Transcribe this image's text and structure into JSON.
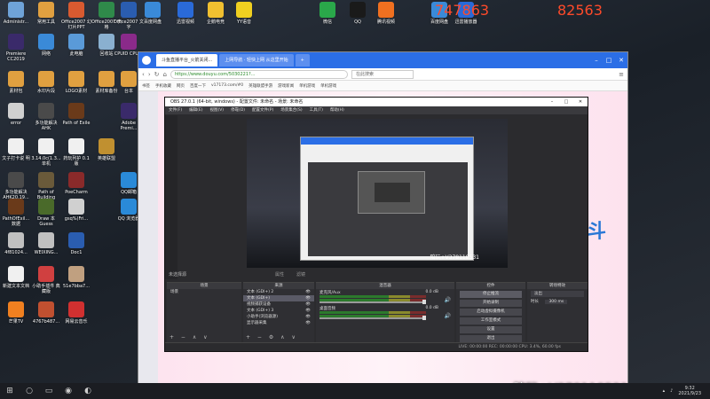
{
  "desktop": {
    "overlay_left": "747863",
    "overlay_right": "82563",
    "watermark": "陪玩+V378118531",
    "left_icons": [
      {
        "label": "Administr...",
        "color": "#6fa3d8"
      },
      {
        "label": "常用工具",
        "color": "#e0a040"
      },
      {
        "label": "Office2007 幻灯片PPT",
        "color": "#d85a30"
      },
      {
        "label": "Office2007 表格",
        "color": "#2f8a4a"
      },
      {
        "label": "Office2007 文字",
        "color": "#2a5db0"
      },
      {
        "label": "Premiere CC2019",
        "color": "#3a2a6a"
      },
      {
        "label": "网络",
        "color": "#3a8ad8"
      },
      {
        "label": "此电脑",
        "color": "#5a9ad8"
      },
      {
        "label": "回收站",
        "color": "#8ab0d0"
      },
      {
        "label": "CPUID CPU-Z",
        "color": "#8a2a8a"
      },
      {
        "label": "素材包",
        "color": "#e0a040"
      },
      {
        "label": "水印片段",
        "color": "#e0a040"
      },
      {
        "label": "LOGO素材",
        "color": "#e0a040"
      },
      {
        "label": "素材库备份",
        "color": "#e0a040"
      },
      {
        "label": "台本",
        "color": "#e0a040"
      },
      {
        "label": "error",
        "color": "#d0d0d0"
      },
      {
        "label": "多功能解决 AHK",
        "color": "#4a4a4a"
      },
      {
        "label": "Path of Exile",
        "color": "#6a3a1a"
      },
      {
        "label": "Adobe Premi...",
        "color": "#3a2a6a"
      },
      {
        "label": "文子打卡说 明",
        "color": "#f0f0f0"
      },
      {
        "label": "3.14.0c(1.3... 单机",
        "color": "#f0f0f0"
      },
      {
        "label": "药玩列护 0.1 版",
        "color": "#f0f0f0"
      },
      {
        "label": "英雄联盟",
        "color": "#c09030"
      },
      {
        "label": "多功能解决 AHK20.19...",
        "color": "#4a4a4a"
      },
      {
        "label": "Path of Building",
        "color": "#6a5a3a"
      },
      {
        "label": "PoeCharm",
        "color": "#8a2a2a"
      },
      {
        "label": "QQ邮箱",
        "color": "#2a8ad8"
      },
      {
        "label": "PathOfExil... 数据",
        "color": "#6a3a1a"
      },
      {
        "label": "Draw 本 Guess",
        "color": "#4a6a2a"
      },
      {
        "label": "gsq%(Fri...",
        "color": "#d0d0d0"
      },
      {
        "label": "QQ 浏览器",
        "color": "#2a8ad8"
      },
      {
        "label": "4f81024...",
        "color": "#c0c0c0"
      },
      {
        "label": "WEIXING...",
        "color": "#c0c0c0"
      },
      {
        "label": "Doc1",
        "color": "#2a5db0"
      },
      {
        "label": "新建文本文档",
        "color": "#f0f0f0"
      },
      {
        "label": "小助手插件 典藏版",
        "color": "#d04040"
      },
      {
        "label": "51e7bba7...",
        "color": "#c0a080"
      },
      {
        "label": "芒果TV",
        "color": "#f08020"
      },
      {
        "label": "4767b487...",
        "color": "#c05030"
      },
      {
        "label": "网易云音乐",
        "color": "#d03030"
      }
    ],
    "top_icons": [
      {
        "label": "百度网盘",
        "color": "#3a8ad8"
      },
      {
        "label": "迅雷视频",
        "color": "#2a6ad8"
      },
      {
        "label": "企鹅电竞",
        "color": "#f0c030"
      },
      {
        "label": "YY语音",
        "color": "#f0d020"
      },
      {
        "label": "微信",
        "color": "#2aa84a"
      },
      {
        "label": "QQ",
        "color": "#1a1a1a"
      },
      {
        "label": "腾讯视频",
        "color": "#f07020"
      },
      {
        "label": "百度网盘",
        "color": "#3a8ad8"
      },
      {
        "label": "迅雷播放器",
        "color": "#2a6ad8"
      }
    ]
  },
  "browser": {
    "tabs": [
      {
        "label": "斗鱼直播平台_火箭关闭...",
        "active": true
      },
      {
        "label": "上网导航 · 轻快上网 从这里开始",
        "active": false
      }
    ],
    "url": "https://www.douyu.com/5030221?...",
    "search_placeholder": "在此搜索",
    "bookmarks": [
      "书签",
      "手机收藏",
      "网页",
      "百度一下",
      "v17173.com/#0",
      "英雄联盟手游",
      "游戏新闻",
      "单机游戏",
      "单机游戏"
    ]
  },
  "obs": {
    "title": "OBS 27.0.1 (64-bit, windows) - 配置文件: 未命名 - 场景: 未命名",
    "menu": [
      "文件(F)",
      "编辑(E)",
      "视图(V)",
      "停靠(D)",
      "配置文件(P)",
      "场景集合(S)",
      "工具(T)",
      "帮助(H)"
    ],
    "preview_watermark": "陪玩+V378118531",
    "not_selected": "未选择源",
    "label_props": "属性",
    "label_filters": "滤镜",
    "docks": {
      "scenes": {
        "header": "场景",
        "items": [
          "场景"
        ]
      },
      "sources": {
        "header": "来源",
        "items": [
          "文本 (GDI+) 2",
          "文本 (GDI+)",
          "视频捕获设备",
          "文本 (GDI+) 3",
          "小助手(浏览器源)",
          "显示器采集"
        ]
      },
      "mixer": {
        "header": "混音器",
        "channels": [
          {
            "name": "麦克风/Aux",
            "db": "0.0 dB"
          },
          {
            "name": "桌面音频",
            "db": "0.0 dB"
          }
        ]
      },
      "transitions": {
        "header": "转场特效",
        "type": "淡出",
        "duration_label": "时长",
        "duration": "300 ms"
      },
      "controls": {
        "header": "控件",
        "buttons": [
          "停止推流",
          "开始录制",
          "启动虚拟摄像机",
          "工作室模式",
          "设置",
          "退出"
        ]
      }
    },
    "status": "LIVE: 00:00:00   REC: 00:00:00   CPU: 3.4%, 60.00 fps"
  },
  "taskbar": {
    "time": "9:32",
    "date": "2021/9/23"
  }
}
